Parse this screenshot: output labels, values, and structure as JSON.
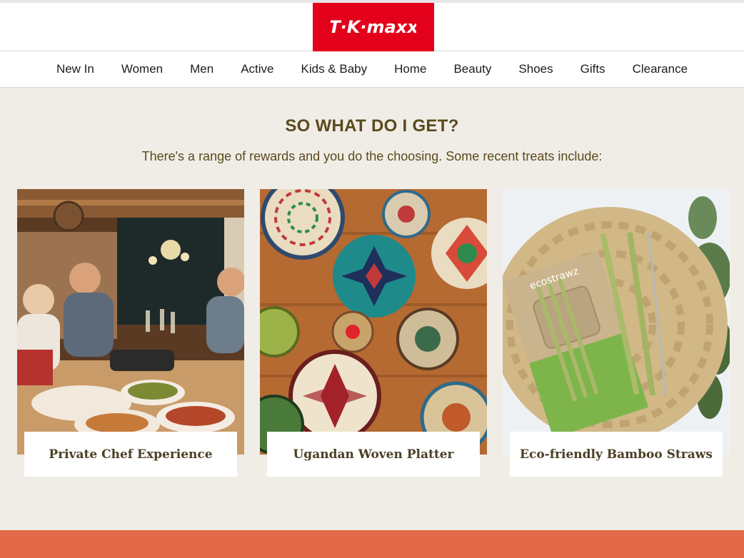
{
  "header": {
    "logo_text": "TK maxx",
    "logo_color": "#e3001b"
  },
  "nav": {
    "items": [
      "New In",
      "Women",
      "Men",
      "Active",
      "Kids & Baby",
      "Home",
      "Beauty",
      "Shoes",
      "Gifts",
      "Clearance"
    ]
  },
  "rewards": {
    "heading": "SO WHAT DO I GET?",
    "subheading": "There's a range of rewards and you do the choosing. Some recent treats include:",
    "cards": [
      {
        "label": "Private Chef Experience"
      },
      {
        "label": "Ugandan Woven Platter"
      },
      {
        "label": "Eco-friendly Bamboo Straws"
      }
    ]
  },
  "colors": {
    "heading": "#5b4a1c",
    "background": "#f0ede7",
    "footer_band": "#e26a47"
  }
}
